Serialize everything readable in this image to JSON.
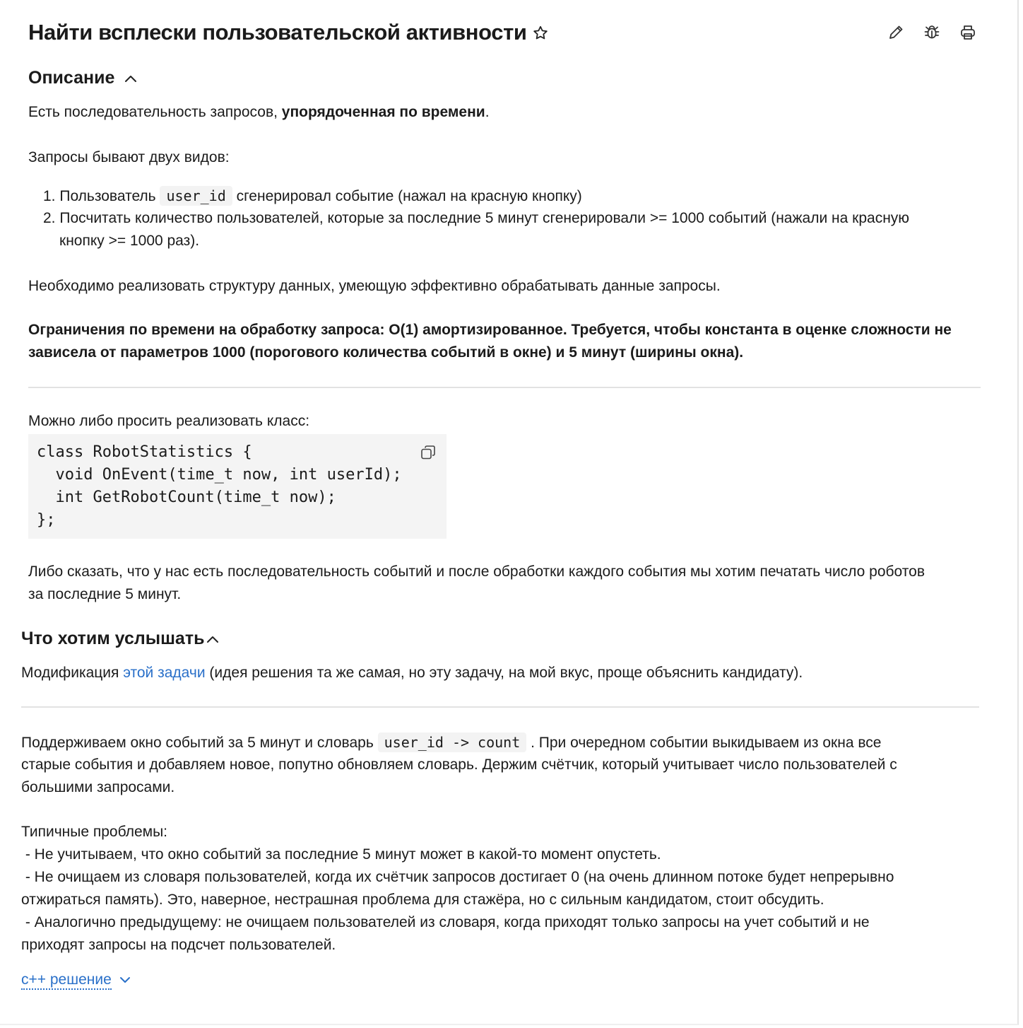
{
  "header": {
    "title": "Найти всплески пользовательской активности",
    "icons": [
      "star-icon",
      "pencil-icon",
      "bug-icon",
      "printer-icon"
    ]
  },
  "description": {
    "heading": "Описание",
    "intro_plain": "Есть последовательность запросов, ",
    "intro_bold": "упорядоченная по времени",
    "intro_end": ".",
    "kinds_label": "Запросы бывают двух видов:",
    "item1_prefix": "1. Пользователь ",
    "item1_code": "user_id",
    "item1_suffix": " сгенерировал событие (нажал на красную кнопку)",
    "item2_line1": "2. Посчитать количество пользователей, которые за последние 5 минут сгенерировали >= 1000 событий (нажали на красную",
    "item2_line2": "кнопку >= 1000 раз).",
    "task": "Необходимо реализовать структуру данных, умеющую эффективно обрабатывать данные запросы.",
    "limits_line1": "Ограничения по времени на обработку запроса: O(1) амортизированное. Требуется, чтобы константа в оценке сложности не",
    "limits_line2": "зависела от параметров 1000 (порогового количества событий в окне) и 5 минут (ширины окна).",
    "class_intro": "Можно либо просить реализовать класс:",
    "code_block": "class RobotStatistics {\n  void OnEvent(time_t now, int userId);\n  int GetRobotCount(time_t now);\n};",
    "alt_line1": "Либо сказать, что у нас есть последовательность событий и после обработки каждого события мы хотим печатать число роботов",
    "alt_line2": "за последние 5 минут."
  },
  "expect": {
    "heading": "Что хотим услышать",
    "mod_prefix": "Модификация ",
    "mod_link": "этой задачи",
    "mod_suffix": " (идея решения та же самая, но эту задачу, на мой вкус, проще объяснить кандидату).",
    "sol_prefix": "Поддерживаем окно событий за 5 минут и словарь ",
    "sol_code": "user_id -> count",
    "sol_suffix": " . При очередном событии выкидываем из окна все",
    "sol_line2": "старые события и добавляем новое, попутно обновляем словарь. Держим счётчик, который учитывает число пользователей с",
    "sol_line3": "большими запросами.",
    "problems_label": "Типичные проблемы:",
    "p1": " - Не учитываем, что окно событий за последние 5 минут может в какой-то момент опустеть.",
    "p2_line1": " - Не очищаем из словаря пользователей, когда их счётчик запросов достигает 0 (на очень длинном потоке будет непрерывно",
    "p2_line2": "отжираться память). Это, наверное, нестрашная проблема для стажёра, но с сильным кандидатом, стоит обсудить.",
    "p3_line1": " - Аналогично предыдущему: не очищаем пользователей из словаря, когда приходят только запросы на учет событий и не",
    "p3_line2": "приходят запросы на подсчет пользователей.",
    "spoiler": "c++ решение"
  }
}
